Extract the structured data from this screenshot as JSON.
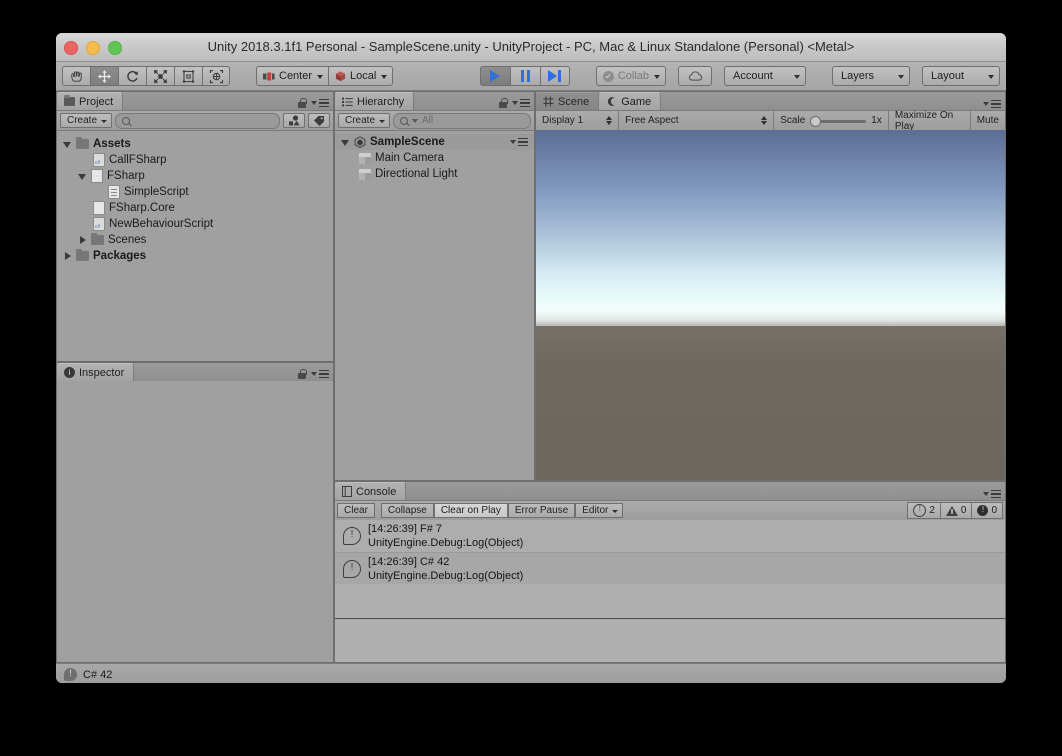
{
  "window": {
    "title": "Unity 2018.3.1f1 Personal - SampleScene.unity - UnityProject - PC, Mac & Linux Standalone (Personal) <Metal>"
  },
  "toolbar": {
    "tools": [
      {
        "name": "hand-tool",
        "icon": "hand-icon",
        "active": false
      },
      {
        "name": "move-tool",
        "icon": "move-icon",
        "active": true
      },
      {
        "name": "rotate-tool",
        "icon": "rotate-icon",
        "active": false
      },
      {
        "name": "scale-tool",
        "icon": "scale-icon",
        "active": false
      },
      {
        "name": "rect-tool",
        "icon": "rect-transform-icon",
        "active": false
      },
      {
        "name": "transform-tool",
        "icon": "transform-icon",
        "active": false
      }
    ],
    "pivot_label": "Center",
    "rotation_label": "Local",
    "play_label": "Play",
    "pause_label": "Pause",
    "step_label": "Step",
    "collab_label": "Collab",
    "cloud_label": "Cloud",
    "account_label": "Account",
    "layers_label": "Layers",
    "layout_label": "Layout"
  },
  "project_panel": {
    "tab_label": "Project",
    "create_label": "Create",
    "search_placeholder": "",
    "tree": [
      {
        "label": "Assets",
        "indent": 0,
        "arrow": "down",
        "icon": "folder-icon",
        "bold": true
      },
      {
        "label": "CallFSharp",
        "indent": 2,
        "arrow": "none",
        "icon": "csharp-file-icon",
        "bold": false
      },
      {
        "label": "FSharp",
        "indent": 1,
        "arrow": "down",
        "icon": "file-icon",
        "bold": false
      },
      {
        "label": "SimpleScript",
        "indent": 3,
        "arrow": "none",
        "icon": "text-file-icon",
        "bold": false
      },
      {
        "label": "FSharp.Core",
        "indent": 2,
        "arrow": "none",
        "icon": "file-icon",
        "bold": false
      },
      {
        "label": "NewBehaviourScript",
        "indent": 2,
        "arrow": "none",
        "icon": "csharp-file-icon",
        "bold": false
      },
      {
        "label": "Scenes",
        "indent": 1,
        "arrow": "right",
        "icon": "folder-icon",
        "bold": false
      },
      {
        "label": "Packages",
        "indent": 0,
        "arrow": "right",
        "icon": "folder-icon",
        "bold": true
      }
    ]
  },
  "inspector_panel": {
    "tab_label": "Inspector"
  },
  "hierarchy_panel": {
    "tab_label": "Hierarchy",
    "create_label": "Create",
    "search_placeholder": "All",
    "tree": [
      {
        "label": "SampleScene",
        "indent": 0,
        "arrow": "down",
        "icon": "unity-scene-icon",
        "bold": true
      },
      {
        "label": "Main Camera",
        "indent": 1,
        "arrow": "none",
        "icon": "gameobject-cube-icon",
        "bold": false
      },
      {
        "label": "Directional Light",
        "indent": 1,
        "arrow": "none",
        "icon": "gameobject-cube-icon",
        "bold": false
      }
    ]
  },
  "game_panel": {
    "tab_scene": "Scene",
    "tab_game": "Game",
    "display_label": "Display 1",
    "aspect_label": "Free Aspect",
    "scale_label": "Scale",
    "scale_value": "1x",
    "maximize_label": "Maximize On Play",
    "mute_label": "Mute"
  },
  "console_panel": {
    "tab_label": "Console",
    "clear_label": "Clear",
    "collapse_label": "Collapse",
    "clear_on_play_label": "Clear on Play",
    "error_pause_label": "Error Pause",
    "editor_label": "Editor",
    "info_count": "2",
    "warning_count": "0",
    "error_count": "0",
    "messages": [
      {
        "title": "[14:26:39] F# 7",
        "detail": "UnityEngine.Debug:Log(Object)",
        "icon": "info-icon"
      },
      {
        "title": "[14:26:39] C# 42",
        "detail": "UnityEngine.Debug:Log(Object)",
        "icon": "info-icon"
      }
    ]
  },
  "status_bar": {
    "message": "C# 42"
  },
  "colors": {
    "accent_blue": "#2f6fe0",
    "panel_bg": "#a0a0a0",
    "chrome_bg": "#a5a5a5",
    "sky_top": "#5a6d96",
    "sky_horizon": "#e8fbfb",
    "ground": "#6e6961",
    "light_red": "#eb6560",
    "light_yellow": "#f2bd4d",
    "light_green": "#62c655"
  }
}
